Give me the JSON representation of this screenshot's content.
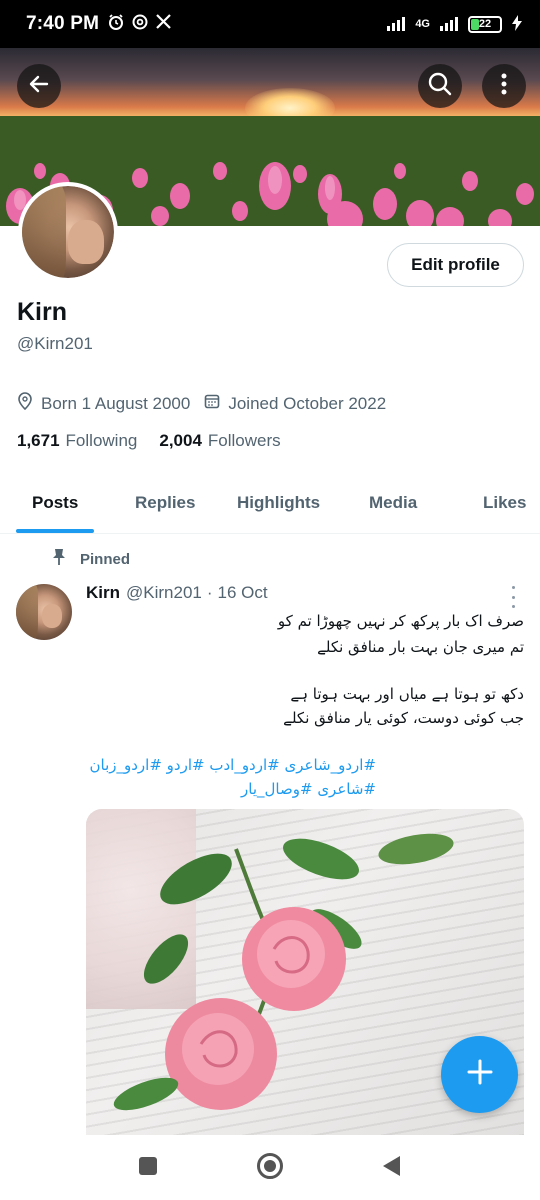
{
  "status_bar": {
    "time": "7:40 PM",
    "left_icons": [
      "alarm-icon",
      "threads-icon",
      "x-logo-icon"
    ],
    "network": "4G",
    "battery": "22",
    "battery_color": "#4cd964"
  },
  "header": {
    "back_icon": "arrow-left-icon",
    "search_icon": "search-icon",
    "more_icon": "more-vertical-icon"
  },
  "profile": {
    "name": "Kirn",
    "handle": "@Kirn201",
    "edit_label": "Edit profile",
    "born": "Born 1 August 2000",
    "joined": "Joined October 2022",
    "following_count": "1,671",
    "following_label": "Following",
    "followers_count": "2,004",
    "followers_label": "Followers"
  },
  "tabs": [
    {
      "label": "Posts",
      "active": true
    },
    {
      "label": "Replies",
      "active": false
    },
    {
      "label": "Highlights",
      "active": false
    },
    {
      "label": "Media",
      "active": false
    },
    {
      "label": "Likes",
      "active": false
    }
  ],
  "post": {
    "pinned_label": "Pinned",
    "author_name": "Kirn",
    "author_handle": "@Kirn201",
    "separator": "·",
    "date": "16 Oct",
    "lines": [
      "صرف اک بار پرکھ کر نہیں چھوڑا تم کو",
      "تم میری جان بہت بار منافق نکلے",
      "دکھ تو ہوتا ہے میاں اور بہت ہوتا ہے",
      "جب کوئی دوست، کوئی یار منافق نکلے"
    ],
    "hashtags_line1": "#اردو_شاعری #اردو_ادب #اردو #اردو_زبان",
    "hashtags_line2": "#شاعری #وصال_یار"
  },
  "colors": {
    "accent": "#1d9bf0",
    "text_primary": "#0f1419",
    "text_secondary": "#536471"
  },
  "nav": [
    "recents-square-icon",
    "home-circle-icon",
    "back-triangle-icon"
  ]
}
